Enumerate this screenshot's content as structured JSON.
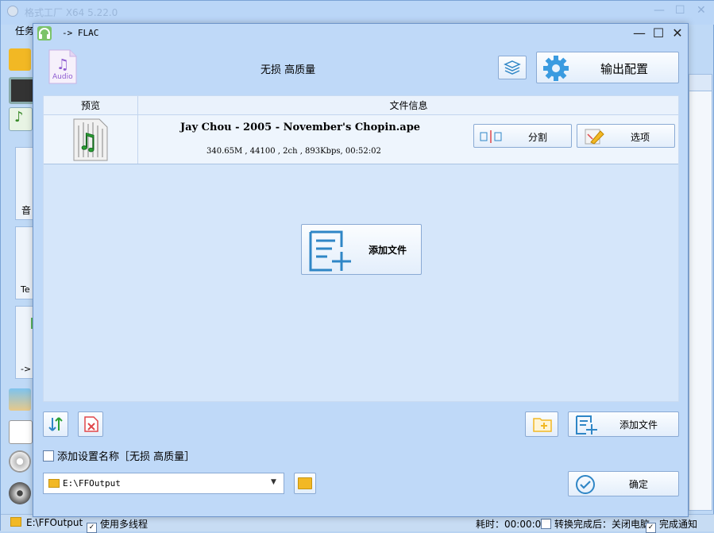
{
  "main_window": {
    "title": "格式工厂 X64 5.22.0",
    "menu_label": "任务",
    "side_labels": [
      "音",
      "Te",
      "->"
    ]
  },
  "dialog": {
    "title": "-> FLAC",
    "controls": {
      "minimize": "—",
      "maximize": "☐",
      "close": "✕"
    },
    "profile_label": "无损 高质量",
    "output_config_label": "输出配置",
    "audio_icon_label": "Audio",
    "table": {
      "headers": [
        "预览",
        "文件信息"
      ],
      "rows": [
        {
          "filename": "Jay Chou - 2005 - November's Chopin.ape",
          "details": "340.65M , 44100 , 2ch , 893Kbps, 00:52:02",
          "split_label": "分割",
          "options_label": "选项"
        }
      ]
    },
    "center_add_label": "添加文件",
    "bottom_add_label": "添加文件",
    "add_setting_name_label": "添加设置名称［无损 高质量］",
    "output_path": "E:\\FFOutput",
    "ok_label": "确定"
  },
  "statusbar": {
    "path": "E:\\FFOutput",
    "multithread_label": "使用多线程",
    "elapsed": "耗时：00:00:00",
    "after_convert": "转换完成后：关闭电脑",
    "notify": "完成通知"
  },
  "colors": {
    "accent": "#2f86c6",
    "window_bg": "#bfd9f8",
    "table_bg": "#d5e6fa",
    "danger": "#e0464a",
    "folder": "#f2b824"
  }
}
